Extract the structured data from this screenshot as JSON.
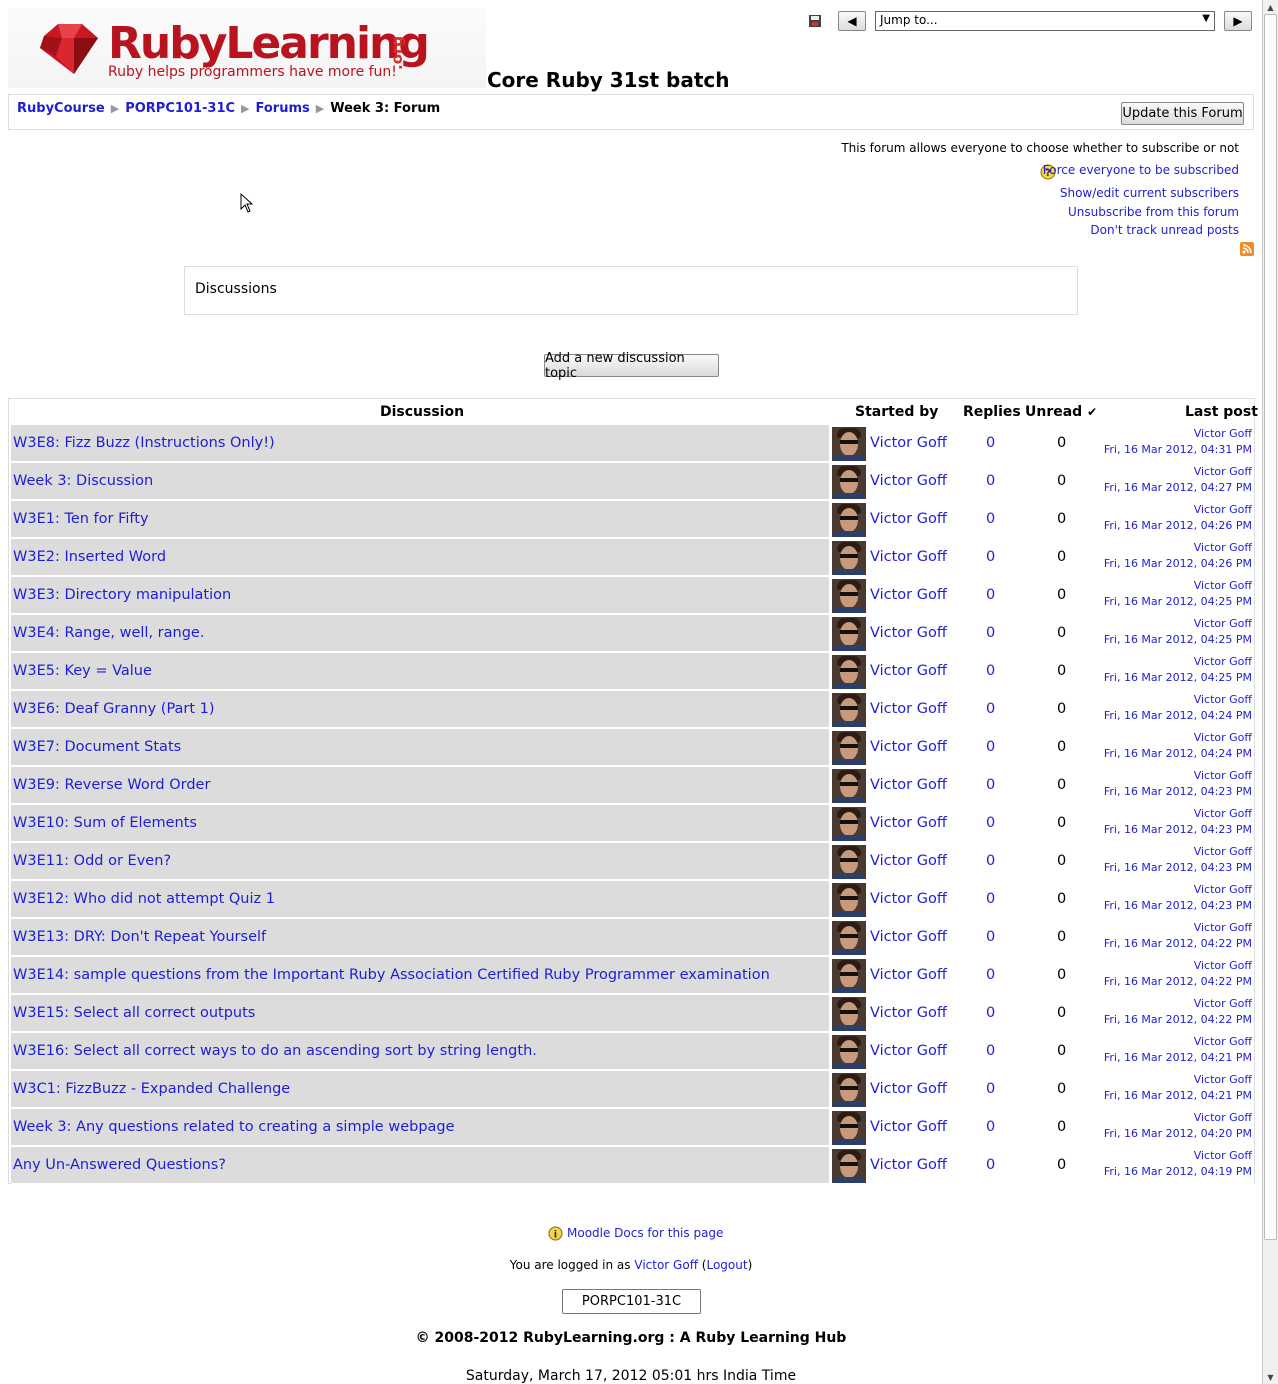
{
  "header": {
    "logo_text": "RubyLearning",
    "logo_org": ".org",
    "logo_tagline": "Ruby helps programmers have more fun!",
    "course_title": "Core Ruby 31st batch",
    "jump_to_label": "Jump to...",
    "prev_label": "◀",
    "next_label": "▶"
  },
  "breadcrumb": {
    "items": [
      "RubyCourse",
      "PORPC101-31C",
      "Forums"
    ],
    "current": "Week 3: Forum",
    "separator": "▶"
  },
  "update_button": "Update this Forum",
  "subscription": {
    "notice": "This forum allows everyone to choose whether to subscribe or not",
    "force_link": "Force everyone to be subscribed",
    "show_subscribers": "Show/edit current subscribers",
    "unsubscribe": "Unsubscribe from this forum",
    "track": "Don't track unread posts"
  },
  "discussions_heading": "Discussions",
  "add_topic_button": "Add a new discussion topic",
  "table": {
    "headers": {
      "discussion": "Discussion",
      "started_by": "Started by",
      "replies": "Replies",
      "unread": "Unread",
      "unread_mark": "✔",
      "last_post": "Last post"
    },
    "rows": [
      {
        "title": "W3E8: Fizz Buzz (Instructions Only!)",
        "starter": "Victor Goff",
        "replies": "0",
        "unread": "0",
        "last_by": "Victor Goff",
        "last_date": "Fri, 16 Mar 2012, 04:31 PM"
      },
      {
        "title": "Week 3: Discussion",
        "starter": "Victor Goff",
        "replies": "0",
        "unread": "0",
        "last_by": "Victor Goff",
        "last_date": "Fri, 16 Mar 2012, 04:27 PM"
      },
      {
        "title": "W3E1: Ten for Fifty",
        "starter": "Victor Goff",
        "replies": "0",
        "unread": "0",
        "last_by": "Victor Goff",
        "last_date": "Fri, 16 Mar 2012, 04:26 PM"
      },
      {
        "title": "W3E2: Inserted Word",
        "starter": "Victor Goff",
        "replies": "0",
        "unread": "0",
        "last_by": "Victor Goff",
        "last_date": "Fri, 16 Mar 2012, 04:26 PM"
      },
      {
        "title": "W3E3: Directory manipulation",
        "starter": "Victor Goff",
        "replies": "0",
        "unread": "0",
        "last_by": "Victor Goff",
        "last_date": "Fri, 16 Mar 2012, 04:25 PM"
      },
      {
        "title": "W3E4: Range, well, range.",
        "starter": "Victor Goff",
        "replies": "0",
        "unread": "0",
        "last_by": "Victor Goff",
        "last_date": "Fri, 16 Mar 2012, 04:25 PM"
      },
      {
        "title": "W3E5: Key = Value",
        "starter": "Victor Goff",
        "replies": "0",
        "unread": "0",
        "last_by": "Victor Goff",
        "last_date": "Fri, 16 Mar 2012, 04:25 PM"
      },
      {
        "title": "W3E6: Deaf Granny (Part 1)",
        "starter": "Victor Goff",
        "replies": "0",
        "unread": "0",
        "last_by": "Victor Goff",
        "last_date": "Fri, 16 Mar 2012, 04:24 PM"
      },
      {
        "title": "W3E7: Document Stats",
        "starter": "Victor Goff",
        "replies": "0",
        "unread": "0",
        "last_by": "Victor Goff",
        "last_date": "Fri, 16 Mar 2012, 04:24 PM"
      },
      {
        "title": "W3E9: Reverse Word Order",
        "starter": "Victor Goff",
        "replies": "0",
        "unread": "0",
        "last_by": "Victor Goff",
        "last_date": "Fri, 16 Mar 2012, 04:23 PM"
      },
      {
        "title": "W3E10: Sum of Elements",
        "starter": "Victor Goff",
        "replies": "0",
        "unread": "0",
        "last_by": "Victor Goff",
        "last_date": "Fri, 16 Mar 2012, 04:23 PM"
      },
      {
        "title": "W3E11: Odd or Even?",
        "starter": "Victor Goff",
        "replies": "0",
        "unread": "0",
        "last_by": "Victor Goff",
        "last_date": "Fri, 16 Mar 2012, 04:23 PM"
      },
      {
        "title": "W3E12: Who did not attempt Quiz 1",
        "starter": "Victor Goff",
        "replies": "0",
        "unread": "0",
        "last_by": "Victor Goff",
        "last_date": "Fri, 16 Mar 2012, 04:23 PM"
      },
      {
        "title": "W3E13: DRY: Don't Repeat Yourself",
        "starter": "Victor Goff",
        "replies": "0",
        "unread": "0",
        "last_by": "Victor Goff",
        "last_date": "Fri, 16 Mar 2012, 04:22 PM"
      },
      {
        "title": "W3E14: sample questions from the Important Ruby Association Certified Ruby Programmer examination",
        "starter": "Victor Goff",
        "replies": "0",
        "unread": "0",
        "last_by": "Victor Goff",
        "last_date": "Fri, 16 Mar 2012, 04:22 PM"
      },
      {
        "title": "W3E15: Select all correct outputs",
        "starter": "Victor Goff",
        "replies": "0",
        "unread": "0",
        "last_by": "Victor Goff",
        "last_date": "Fri, 16 Mar 2012, 04:22 PM"
      },
      {
        "title": "W3E16: Select all correct ways to do an ascending sort by string length.",
        "starter": "Victor Goff",
        "replies": "0",
        "unread": "0",
        "last_by": "Victor Goff",
        "last_date": "Fri, 16 Mar 2012, 04:21 PM"
      },
      {
        "title": "W3C1: FizzBuzz - Expanded Challenge",
        "starter": "Victor Goff",
        "replies": "0",
        "unread": "0",
        "last_by": "Victor Goff",
        "last_date": "Fri, 16 Mar 2012, 04:21 PM"
      },
      {
        "title": "Week 3: Any questions related to creating a simple webpage",
        "starter": "Victor Goff",
        "replies": "0",
        "unread": "0",
        "last_by": "Victor Goff",
        "last_date": "Fri, 16 Mar 2012, 04:20 PM"
      },
      {
        "title": "Any Un-Answered Questions?",
        "starter": "Victor Goff",
        "replies": "0",
        "unread": "0",
        "last_by": "Victor Goff",
        "last_date": "Fri, 16 Mar 2012, 04:19 PM"
      }
    ]
  },
  "footer": {
    "docs_link": "Moodle Docs for this page",
    "logged_prefix": "You are logged in as",
    "user": "Victor Goff",
    "logout": "Logout",
    "course_button": "PORPC101-31C",
    "copyright": "© 2008-2012 RubyLearning.org : A Ruby Learning Hub",
    "timeline": "Saturday, March 17, 2012 05:01 hrs India Time"
  },
  "colors": {
    "link": "#1e1ed6",
    "brand": "#b8141f",
    "row_bg": "#dcdcdc"
  },
  "icons": [
    "ruby-gem-icon",
    "save-icon",
    "help-icon",
    "rss-icon",
    "info-icon",
    "mouse-cursor-icon"
  ]
}
